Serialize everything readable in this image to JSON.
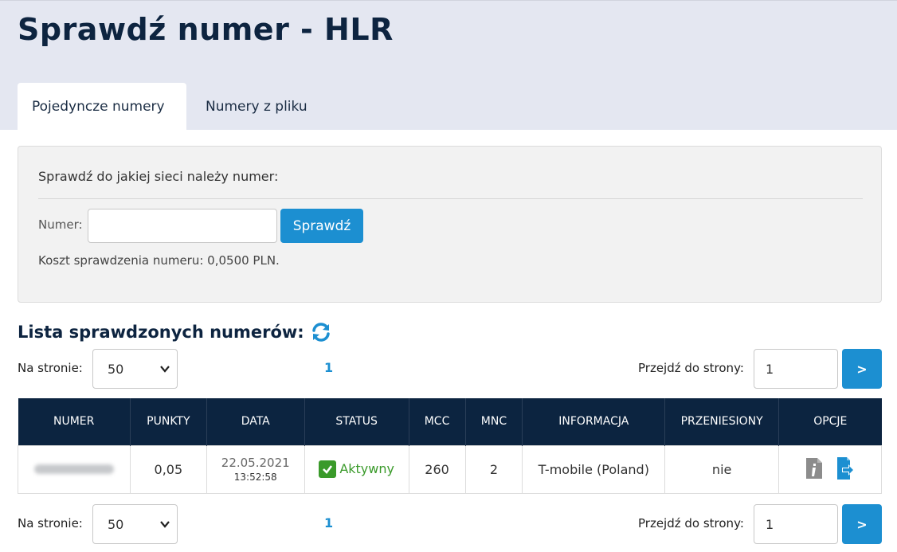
{
  "page": {
    "title": "Sprawdź numer - HLR"
  },
  "tabs": [
    {
      "label": "Pojedyncze numery",
      "active": true
    },
    {
      "label": "Numery z pliku",
      "active": false
    }
  ],
  "check_panel": {
    "heading": "Sprawdź do jakiej sieci należy numer:",
    "number_label": "Numer:",
    "number_value": "",
    "button_label": "Sprawdź",
    "cost_text": "Koszt sprawdzenia numeru: 0,0500 PLN."
  },
  "list": {
    "title": "Lista sprawdzonych numerów:"
  },
  "pager": {
    "per_page_label": "Na stronie:",
    "per_page_value": "50",
    "current_page": "1",
    "goto_label": "Przejdź do strony:",
    "goto_value": "1",
    "goto_button": ">"
  },
  "table": {
    "headers": [
      "NUMER",
      "PUNKTY",
      "DATA",
      "STATUS",
      "MCC",
      "MNC",
      "INFORMACJA",
      "PRZENIESIONY",
      "OPCJE"
    ],
    "rows": [
      {
        "numer": "",
        "punkty": "0,05",
        "data_date": "22.05.2021",
        "data_time": "13:52:58",
        "status": "Aktywny",
        "mcc": "260",
        "mnc": "2",
        "informacja": "T-mobile (Poland)",
        "przeniesiony": "nie"
      }
    ]
  },
  "colors": {
    "header_bg": "#e4e7f1",
    "title": "#0d2440",
    "accent": "#1c8fd1",
    "table_header": "#0c2440",
    "status_green": "#3a9a2a"
  },
  "icons": [
    "refresh-icon",
    "chevron-down-icon",
    "check-icon",
    "info-file-icon",
    "export-icon"
  ]
}
